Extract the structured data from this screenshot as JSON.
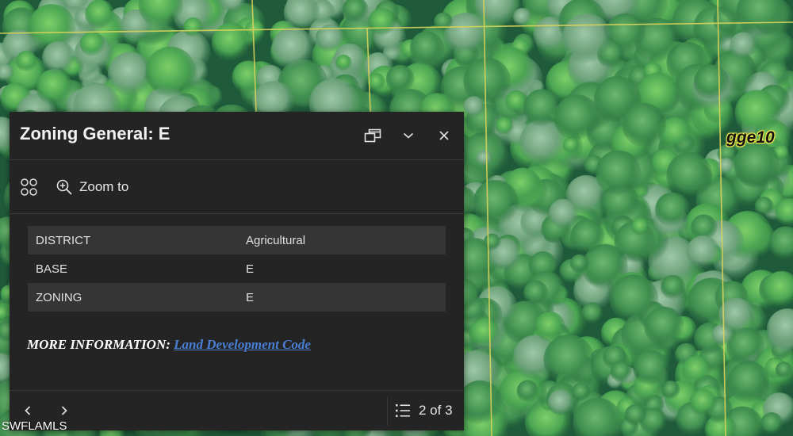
{
  "map": {
    "parcel_label": "gge10",
    "watermark": "SWFLAMLS",
    "colors": {
      "canopy_dark": "#1f5b3a",
      "canopy_light": "#4c9a5a",
      "parcel_line": "#d9d35a"
    }
  },
  "popup": {
    "title": "Zoning General: E",
    "header_icons": {
      "dock": "dock-icon",
      "collapse": "chevron-down-icon",
      "close": "close-icon"
    },
    "actions": {
      "menu_icon": "actions-grid-icon",
      "zoom_icon": "zoom-in-icon",
      "zoom_label": "Zoom to"
    },
    "attributes": [
      {
        "field": "DISTRICT",
        "value": "Agricultural"
      },
      {
        "field": "BASE",
        "value": "E"
      },
      {
        "field": "ZONING",
        "value": "E"
      }
    ],
    "more_info": {
      "prefix": "MORE INFORMATION:",
      "link_text": "Land Development Code"
    },
    "footer": {
      "prev_icon": "chevron-left-icon",
      "next_icon": "chevron-right-icon",
      "list_icon": "list-icon",
      "pager": "2 of 3"
    },
    "colors": {
      "background": "#242424",
      "row_shade": "#353535",
      "link": "#4a7fd6"
    }
  }
}
